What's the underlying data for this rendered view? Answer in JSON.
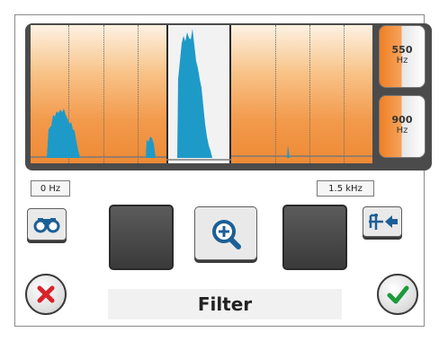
{
  "spectrum": {
    "filter_low": {
      "value": "550",
      "unit": "Hz"
    },
    "filter_high": {
      "value": "900",
      "unit": "Hz"
    },
    "axis_min_label": "0 Hz",
    "axis_max_label": "1.5 kHz"
  },
  "toolbar": {
    "binoculars_icon": "binoculars-icon",
    "zoom_icon": "zoom-in-icon",
    "route_icon": "route-back-icon"
  },
  "footer": {
    "title": "Filter",
    "cancel_icon": "cancel-x-icon",
    "confirm_icon": "confirm-check-icon"
  },
  "colors": {
    "accent_orange": "#f28a2a",
    "signal_blue": "#1e9ac8",
    "cancel_red": "#d9222a",
    "confirm_green": "#1c9a3a"
  }
}
